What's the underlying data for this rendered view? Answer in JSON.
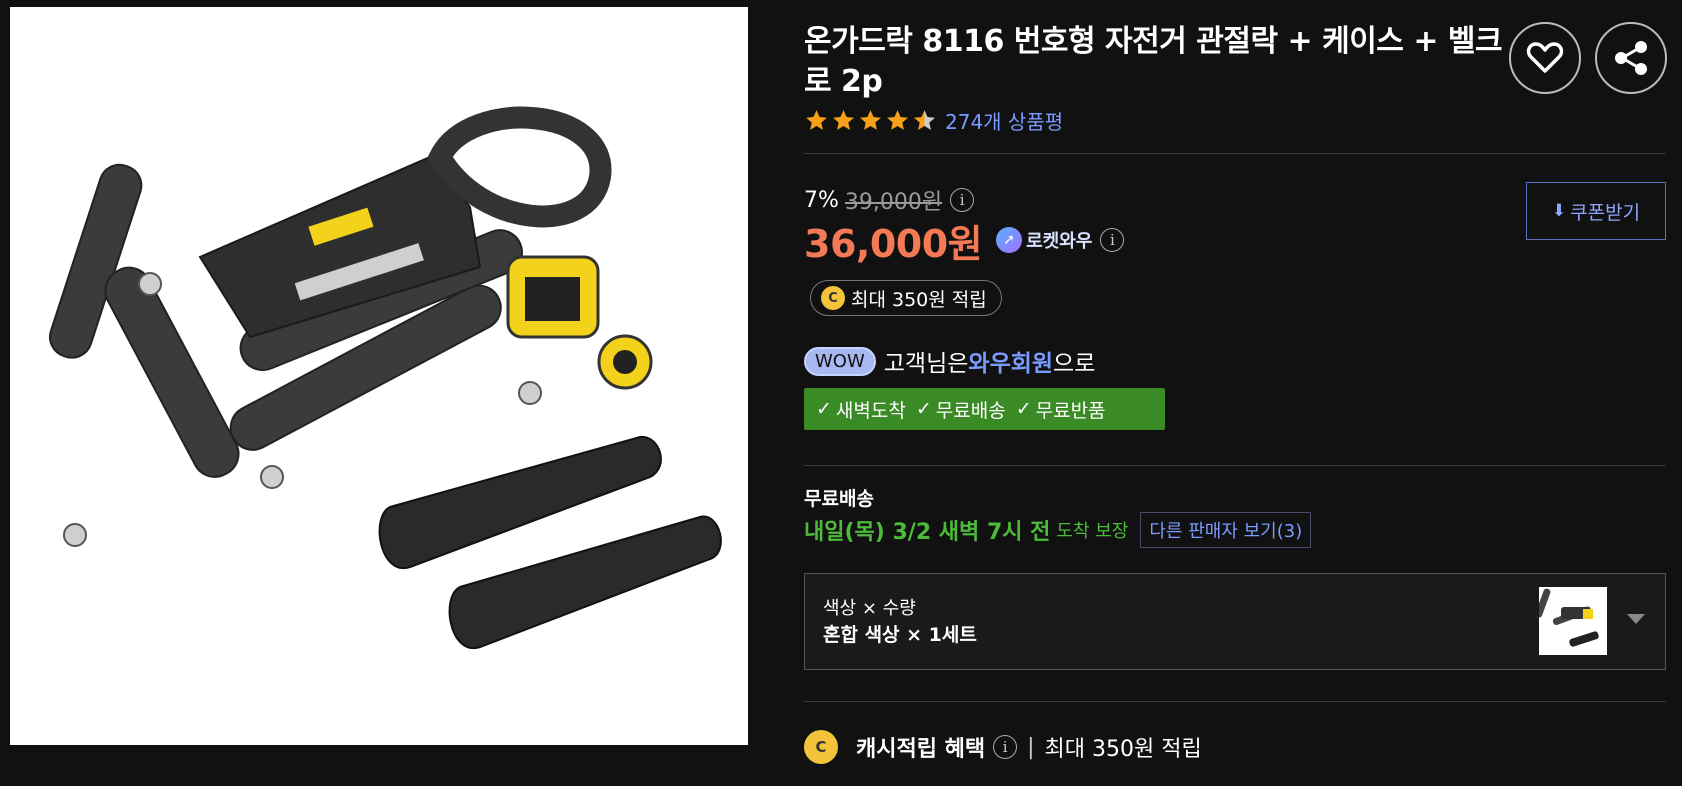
{
  "product": {
    "title": "온가드락 8116 번호형 자전거 관절락 + 케이스 + 벨크로 2p",
    "rating": 4.5,
    "review_count": "274개 상품평"
  },
  "pricing": {
    "discount_rate": "7%",
    "original_price": "39,000원",
    "price": "36,000원",
    "rocket_label": "로켓와우",
    "info_glyph": "i"
  },
  "coupon": {
    "label": "쿠폰받기"
  },
  "cashback_pill": {
    "coin_label": "C",
    "text": "최대 350원 적립"
  },
  "wow": {
    "badge": "WOW",
    "text_before": "고객님은 ",
    "member": "와우회원",
    "text_after": "으로"
  },
  "benefits": [
    "새벽도착",
    "무료배송",
    "무료반품"
  ],
  "shipping": {
    "title": "무료배송",
    "date": "내일(목) 3/2 새벽 7시 전",
    "guarantee": "도착 보장",
    "other_seller": "다른 판매자 보기(3)"
  },
  "option": {
    "label": "색상 × 수량",
    "value": "혼합 색상 × 1세트"
  },
  "cash_benefit": {
    "coin_label": "C",
    "title": "캐시적립 혜택",
    "separator": "|",
    "max": "최대 350원 적립"
  },
  "colors": {
    "background": "#111111",
    "price": "#f47a55",
    "link": "#7a9bff",
    "benefit_bar": "#3a8a25",
    "ship_green": "#4cbb3a",
    "coin": "#f3c33a"
  },
  "icons": [
    "heart-icon",
    "share-icon",
    "star-icon",
    "info-icon",
    "rocket-icon",
    "download-icon",
    "coin-icon",
    "check-icon",
    "chevron-down-icon"
  ]
}
